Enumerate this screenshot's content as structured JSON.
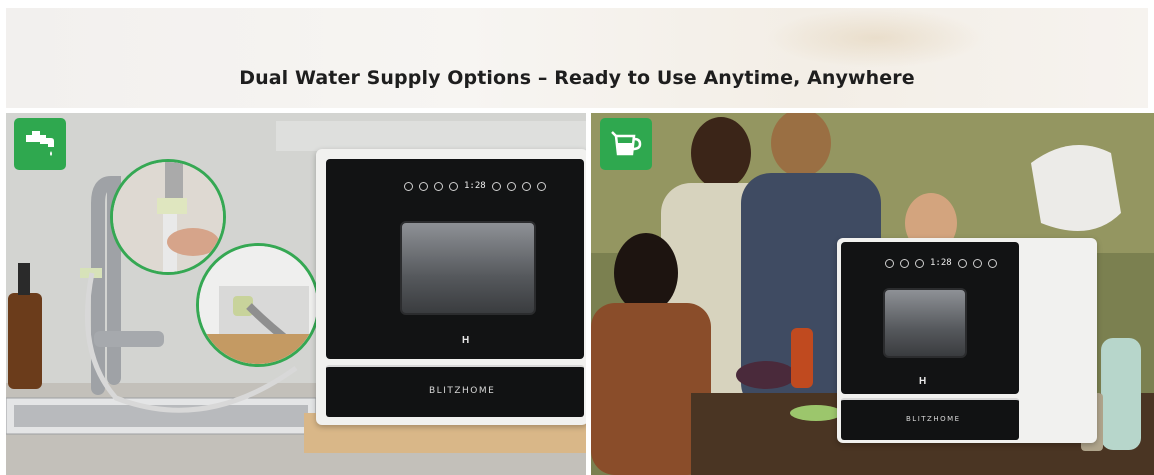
{
  "headline": "Dual Water Supply Options – Ready to Use Anytime, Anywhere",
  "left_panel": {
    "badge_icon": "faucet-icon",
    "washer_display": "1:28",
    "washer_brand": "BLITZHOME"
  },
  "right_panel": {
    "badge_icon": "water-kettle-icon",
    "washer_display": "1:28",
    "washer_brand": "BLITZHOME"
  },
  "colors": {
    "badge_green": "#2fa84f",
    "washer_black": "#121314"
  }
}
